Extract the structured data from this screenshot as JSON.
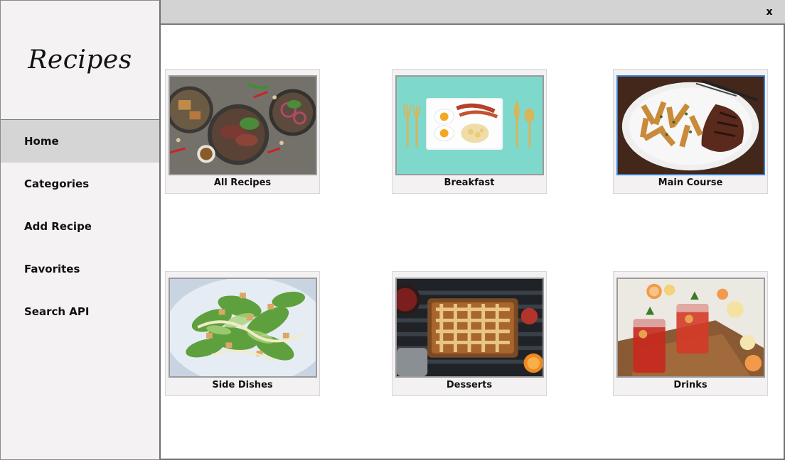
{
  "app": {
    "title": "Recipes",
    "close_label": "x"
  },
  "sidebar": {
    "items": [
      {
        "label": "Home",
        "active": true
      },
      {
        "label": "Categories"
      },
      {
        "label": "Add Recipe"
      },
      {
        "label": "Favorites"
      },
      {
        "label": "Search API"
      }
    ]
  },
  "categories": [
    {
      "label": "All Recipes",
      "image": "platter-image"
    },
    {
      "label": "Breakfast",
      "image": "breakfast-image"
    },
    {
      "label": "Main Course",
      "image": "steak-fries-image",
      "selected": true
    },
    {
      "label": "Side Dishes",
      "image": "salad-image"
    },
    {
      "label": "Desserts",
      "image": "pie-image"
    },
    {
      "label": "Drinks",
      "image": "drinks-image"
    }
  ],
  "colors": {
    "sidebar_bg": "#f4f2f2",
    "active_item_bg": "#d5d5d5",
    "topbar_bg": "#d3d3d3",
    "card_bg": "#f3f1f1",
    "selected_border": "#3d7fd3"
  }
}
